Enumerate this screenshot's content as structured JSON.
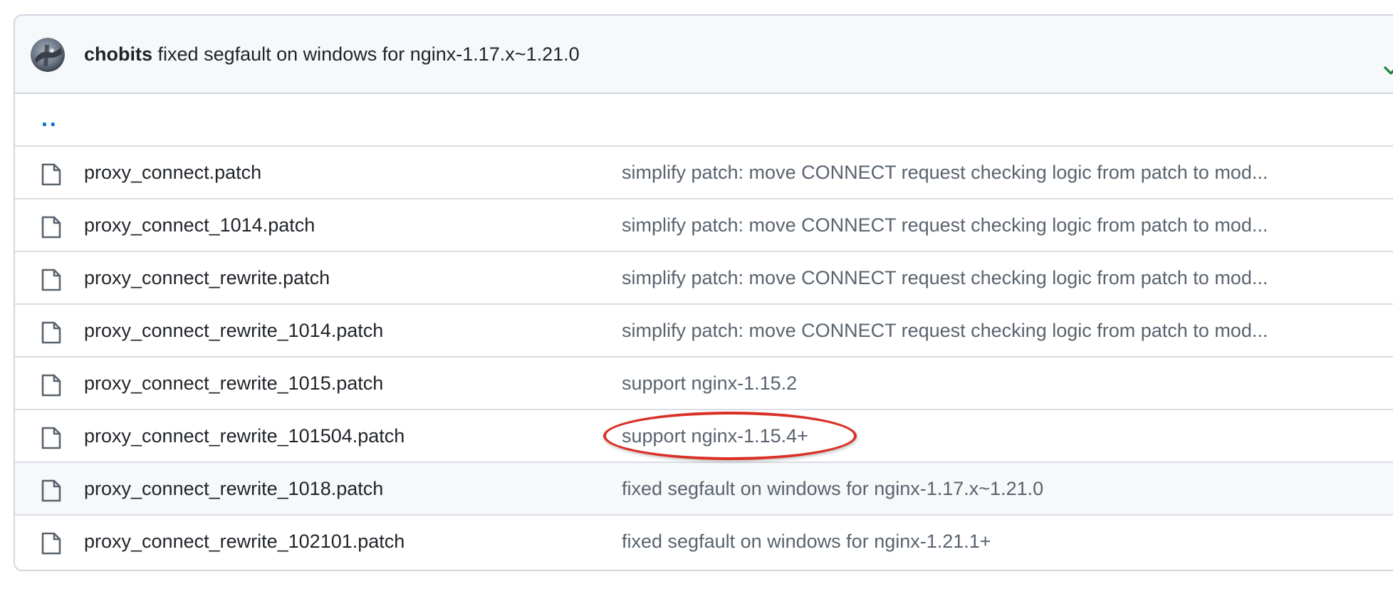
{
  "commit": {
    "author": "chobits",
    "message": "fixed segfault on windows for nginx-1.17.x~1.21.0",
    "status_icon": "check-icon",
    "status_color": "#1a7f37"
  },
  "parent_link": "..",
  "files": [
    {
      "name": "proxy_connect.patch",
      "commit": "simplify patch: move CONNECT request checking logic from patch to mod..."
    },
    {
      "name": "proxy_connect_1014.patch",
      "commit": "simplify patch: move CONNECT request checking logic from patch to mod..."
    },
    {
      "name": "proxy_connect_rewrite.patch",
      "commit": "simplify patch: move CONNECT request checking logic from patch to mod..."
    },
    {
      "name": "proxy_connect_rewrite_1014.patch",
      "commit": "simplify patch: move CONNECT request checking logic from patch to mod..."
    },
    {
      "name": "proxy_connect_rewrite_1015.patch",
      "commit": "support nginx-1.15.2"
    },
    {
      "name": "proxy_connect_rewrite_101504.patch",
      "commit": "support nginx-1.15.4+"
    },
    {
      "name": "proxy_connect_rewrite_1018.patch",
      "commit": "fixed segfault on windows for nginx-1.17.x~1.21.0"
    },
    {
      "name": "proxy_connect_rewrite_102101.patch",
      "commit": "fixed segfault on windows for nginx-1.21.1+"
    }
  ],
  "colors": {
    "link": "#0969da",
    "annotation": "#d93025",
    "border": "#d0d7de"
  }
}
